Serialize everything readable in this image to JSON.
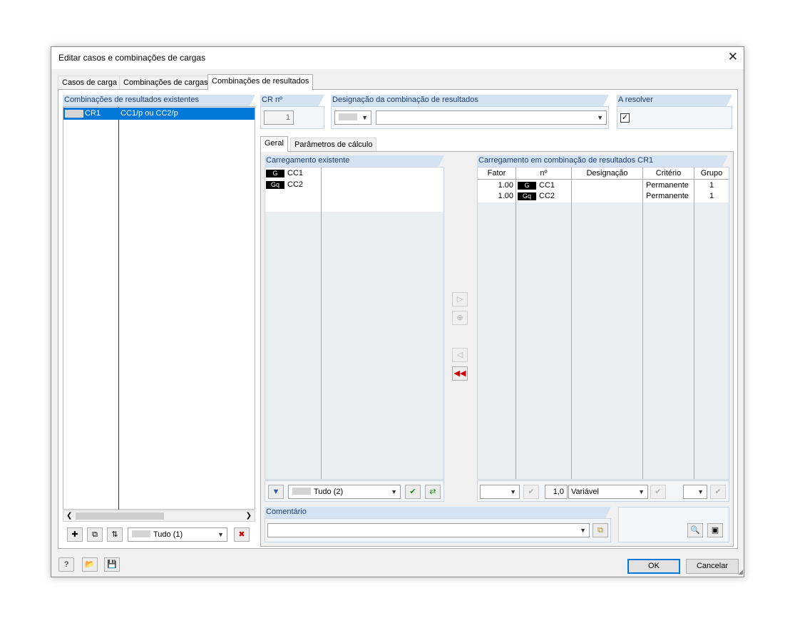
{
  "dialog": {
    "title": "Editar casos e combinações de cargas"
  },
  "tabs": [
    "Casos de carga",
    "Combinações de cargas",
    "Combinações de resultados"
  ],
  "left_panel": {
    "title": "Combinações de resultados existentes",
    "rows": [
      {
        "id": "CR1",
        "desc": "CC1/p ou CC2/p"
      }
    ],
    "filter": "Tudo (1)"
  },
  "cr_no": {
    "label": "CR nº",
    "value": "1"
  },
  "designation": {
    "label": "Designação da combinação de resultados",
    "value": ""
  },
  "resolve": {
    "label": "A resolver"
  },
  "subtabs": [
    "Geral",
    "Parâmetros de cálculo"
  ],
  "existing": {
    "title": "Carregamento existente",
    "rows": [
      {
        "badge": "G",
        "name": "CC1"
      },
      {
        "badge": "Gq",
        "name": "CC2"
      }
    ],
    "filter": "Tudo (2)"
  },
  "combination": {
    "title": "Carregamento em combinação de resultados CR1",
    "headers": {
      "factor": "Fator",
      "no": "nº",
      "designation": "Designação",
      "criterion": "Critério",
      "group": "Grupo"
    },
    "rows": [
      {
        "factor": "1.00",
        "badge": "G",
        "no": "CC1",
        "designation": "",
        "criterion": "Permanente",
        "group": "1"
      },
      {
        "factor": "1.00",
        "badge": "Gq",
        "no": "CC2",
        "designation": "",
        "criterion": "Permanente",
        "group": "1"
      }
    ],
    "factor_value": "1,0",
    "type_value": "Variável"
  },
  "comment": {
    "label": "Comentário",
    "value": ""
  },
  "buttons": {
    "ok": "OK",
    "cancel": "Cancelar"
  },
  "colors": {
    "selection": "#0078d7",
    "group_header": "#d3e3f1",
    "badge": "#000000"
  }
}
